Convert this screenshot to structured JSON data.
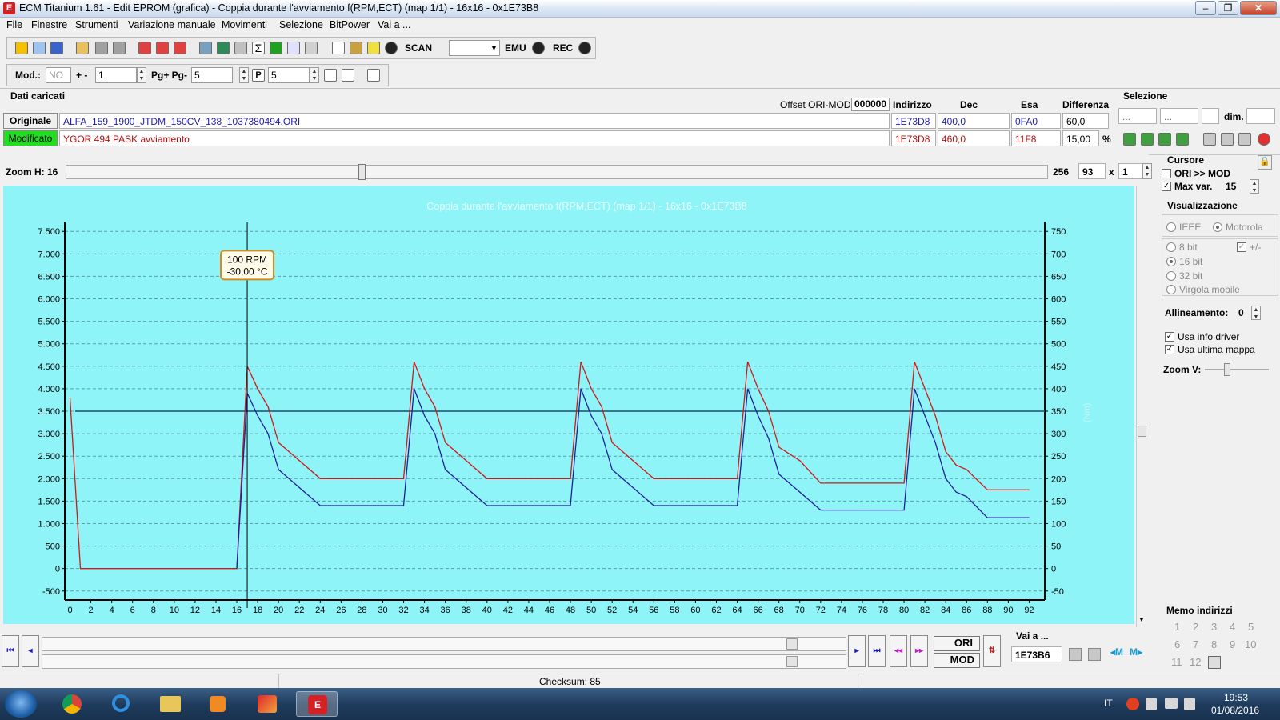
{
  "window": {
    "title": "ECM Titanium 1.61 - Edit EPROM (grafica) - Coppia durante l'avviamento f(RPM,ECT) (map 1/1) - 16x16 - 0x1E73B8",
    "app_icon_glyph": "E"
  },
  "menu": [
    "File",
    "Finestre",
    "Strumenti",
    "Variazione manuale",
    "Movimenti",
    "Selezione",
    "BitPower",
    "Vai a ..."
  ],
  "toolbar1": {
    "scan_label": "SCAN",
    "scan_value": "",
    "emu_label": "EMU",
    "rec_label": "REC"
  },
  "toolbar2": {
    "mod_label": "Mod.:",
    "mod_value": "NO",
    "plusminus_label": "+ -",
    "plusminus_value": "1",
    "pg_label": "Pg+ Pg-",
    "pg_value": "5",
    "p_value": "5"
  },
  "data_panel": {
    "title": "Dati caricati",
    "offset_label": "Offset ORI-MOD",
    "offset_value": "000000",
    "col_indirizzo": "Indirizzo",
    "col_dec": "Dec",
    "col_esa": "Esa",
    "col_diff": "Differenza",
    "originale": {
      "label": "Originale",
      "file": "ALFA_159_1900_JTDM_150CV_138_1037380494.ORI",
      "indirizzo": "1E73D8",
      "dec": "400,0",
      "esa": "0FA0",
      "diff": "60,0"
    },
    "modificato": {
      "label": "Modificato",
      "file": "YGOR 494 PASK avviamento",
      "indirizzo": "1E73D8",
      "dec": "460,0",
      "esa": "11F8",
      "diff": "15,00",
      "diff_unit": "%"
    }
  },
  "selezione": {
    "title": "Selezione",
    "field1": "...",
    "field2": "...",
    "field3": "",
    "dim_label": "dim.",
    "dim_value": ""
  },
  "zoom": {
    "label": "Zoom H: 16",
    "slider_level": 0.3,
    "value_256": "256",
    "value_93": "93",
    "times": "x",
    "value_1": "1"
  },
  "chart_data": {
    "type": "line",
    "title": "Coppia durante l'avviamento f(RPM,ECT) (map 1/1) - 16x16 - 0x1E73B8",
    "right_axis_label": "(Nm)",
    "x_ticks": [
      0,
      2,
      4,
      6,
      8,
      10,
      12,
      14,
      16,
      18,
      20,
      22,
      24,
      26,
      28,
      30,
      32,
      34,
      36,
      38,
      40,
      42,
      44,
      46,
      48,
      50,
      52,
      54,
      56,
      58,
      60,
      62,
      64,
      66,
      68,
      70,
      72,
      74,
      76,
      78,
      80,
      82,
      84,
      86,
      88,
      90,
      92
    ],
    "xlim": [
      -0.5,
      93.5
    ],
    "y_left_ticks": [
      "7.500",
      "7.000",
      "6.500",
      "6.000",
      "5.500",
      "5.000",
      "4.500",
      "4.000",
      "3.500",
      "3.000",
      "2.500",
      "2.000",
      "1.500",
      "1.000",
      "500",
      "0",
      "-500"
    ],
    "y_left_values": [
      7500,
      7000,
      6500,
      6000,
      5500,
      5000,
      4500,
      4000,
      3500,
      3000,
      2500,
      2000,
      1500,
      1000,
      500,
      0,
      -500
    ],
    "y_right_ticks": [
      "750",
      "700",
      "650",
      "600",
      "550",
      "500",
      "450",
      "400",
      "350",
      "300",
      "250",
      "200",
      "150",
      "100",
      "50",
      "0",
      "-50"
    ],
    "ylim": [
      -700,
      7700
    ],
    "reference_line": 3500,
    "cursor": {
      "x": 17,
      "label_rpm": "100 RPM",
      "label_temp": "-30,00 °C"
    },
    "series": [
      {
        "color": "#d01818",
        "points": [
          [
            0,
            3800
          ],
          [
            1,
            0
          ],
          [
            16,
            0
          ],
          [
            17,
            4500
          ],
          [
            18,
            4000
          ],
          [
            19,
            3600
          ],
          [
            20,
            2800
          ],
          [
            22,
            2400
          ],
          [
            24,
            2000
          ],
          [
            32,
            2000
          ],
          [
            33,
            4600
          ],
          [
            34,
            4000
          ],
          [
            35,
            3600
          ],
          [
            36,
            2800
          ],
          [
            38,
            2400
          ],
          [
            40,
            2000
          ],
          [
            48,
            2000
          ],
          [
            49,
            4600
          ],
          [
            50,
            4000
          ],
          [
            51,
            3600
          ],
          [
            52,
            2800
          ],
          [
            54,
            2400
          ],
          [
            56,
            2000
          ],
          [
            64,
            2000
          ],
          [
            65,
            4600
          ],
          [
            66,
            4000
          ],
          [
            67,
            3500
          ],
          [
            68,
            2700
          ],
          [
            70,
            2400
          ],
          [
            72,
            1900
          ],
          [
            80,
            1900
          ],
          [
            81,
            4600
          ],
          [
            82,
            4000
          ],
          [
            83,
            3400
          ],
          [
            84,
            2600
          ],
          [
            85,
            2300
          ],
          [
            86,
            2200
          ],
          [
            88,
            1750
          ],
          [
            92,
            1750
          ]
        ]
      },
      {
        "color": "#1f1f9a",
        "points": [
          [
            16,
            0
          ],
          [
            17,
            3900
          ],
          [
            18,
            3400
          ],
          [
            19,
            3000
          ],
          [
            20,
            2200
          ],
          [
            22,
            1800
          ],
          [
            24,
            1400
          ],
          [
            32,
            1400
          ],
          [
            33,
            4000
          ],
          [
            34,
            3400
          ],
          [
            35,
            3000
          ],
          [
            36,
            2200
          ],
          [
            38,
            1800
          ],
          [
            40,
            1400
          ],
          [
            48,
            1400
          ],
          [
            49,
            4000
          ],
          [
            50,
            3400
          ],
          [
            51,
            3000
          ],
          [
            52,
            2200
          ],
          [
            54,
            1800
          ],
          [
            56,
            1400
          ],
          [
            64,
            1400
          ],
          [
            65,
            4000
          ],
          [
            66,
            3400
          ],
          [
            67,
            2900
          ],
          [
            68,
            2100
          ],
          [
            70,
            1700
          ],
          [
            72,
            1300
          ],
          [
            80,
            1300
          ],
          [
            81,
            4000
          ],
          [
            82,
            3400
          ],
          [
            83,
            2800
          ],
          [
            84,
            2000
          ],
          [
            85,
            1700
          ],
          [
            86,
            1600
          ],
          [
            88,
            1130
          ],
          [
            92,
            1130
          ]
        ]
      }
    ]
  },
  "cursore": {
    "title": "Cursore",
    "ori_mod_label": "ORI >> MOD",
    "max_var_label": "Max var.",
    "max_var_value": "15"
  },
  "visualizzazione": {
    "title": "Visualizzazione",
    "ieee": "IEEE",
    "motorola": "Motorola",
    "bit8": "8 bit",
    "plusminus": "+/-",
    "bit16": "16 bit",
    "bit32": "32 bit",
    "virgola": "Virgola mobile",
    "allineamento_label": "Allineamento:",
    "allineamento_value": "0",
    "usa_info_driver": "Usa info driver",
    "usa_ultima_mappa": "Usa ultima mappa",
    "zoom_v_label": "Zoom V:"
  },
  "memo": {
    "title": "Memo indirizzi",
    "numbers": [
      "1",
      "2",
      "3",
      "4",
      "5",
      "6",
      "7",
      "8",
      "9",
      "10",
      "11",
      "12"
    ]
  },
  "bottom": {
    "ori_label": "ORI",
    "mod_label": "MOD",
    "vai_a_label": "Vai a ...",
    "vai_a_value": "1E73B6",
    "checksum": "Checksum: 85"
  },
  "taskbar": {
    "lang": "IT",
    "time": "19:53",
    "date": "01/08/2016"
  }
}
